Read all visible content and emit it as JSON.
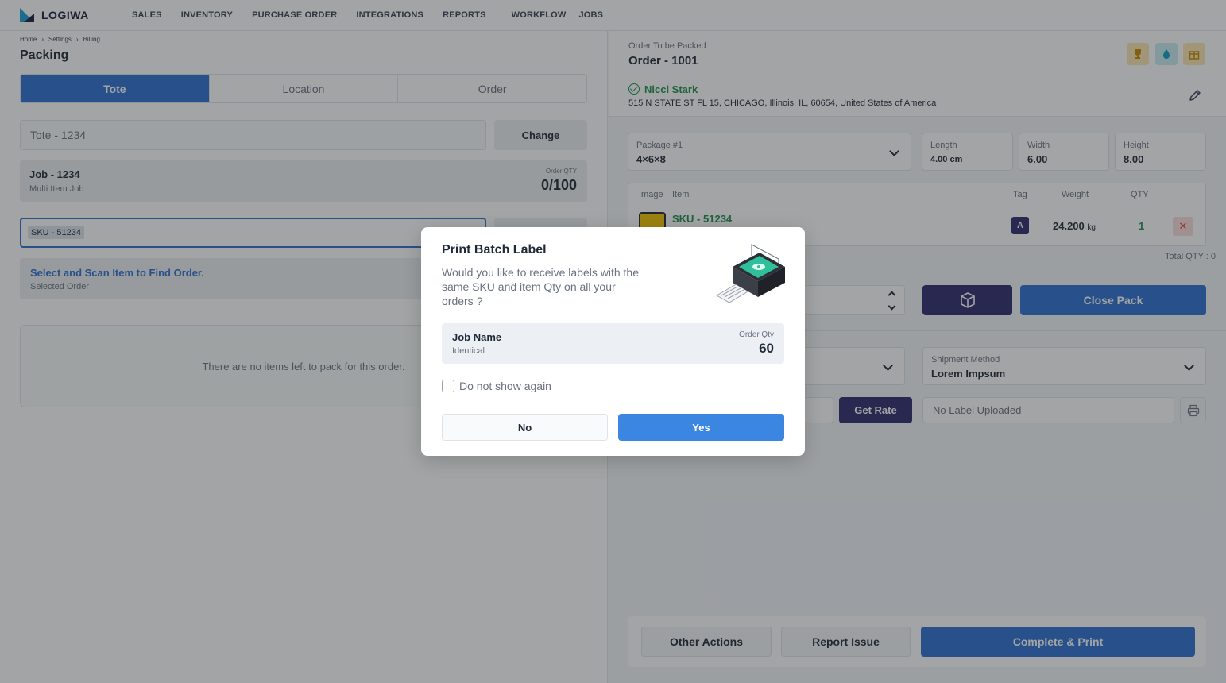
{
  "brand": {
    "name": "LOGIWA"
  },
  "nav": {
    "items": [
      "SALES",
      "INVENTORY",
      "PURCHASE ORDER",
      "INTEGRATIONS",
      "REPORTS",
      "WORKFLOW",
      "JOBS"
    ]
  },
  "left": {
    "breadcrumb": [
      "Home",
      "Settings",
      "Billing"
    ],
    "title": "Packing",
    "tabs": [
      "Tote",
      "Location",
      "Order"
    ],
    "tote_value": "Tote - 1234",
    "change_label": "Change",
    "job": {
      "title": "Job - 1234",
      "subtitle": "Multi Item Job",
      "qty_label": "Order QTY",
      "qty_value": "0/100"
    },
    "sku_value": "SKU - 51234",
    "scan": {
      "title": "Select and Scan Item to Find Order.",
      "subtitle": "Selected Order"
    },
    "empty_text": "There are no items left to pack for this order."
  },
  "right": {
    "order_label": "Order To be Packed",
    "order_title": "Order - 1001",
    "customer": {
      "name": "Nicci Stark",
      "address": "515 N STATE ST FL 15, CHICAGO, Illinois, IL, 60654, United States of America"
    },
    "package": {
      "label": "Package #1",
      "value": "4×6×8"
    },
    "length": {
      "label": "Length",
      "value": "4.00 cm"
    },
    "width": {
      "label": "Width",
      "value": "6.00"
    },
    "height": {
      "label": "Height",
      "value": "8.00"
    },
    "table": {
      "headers": {
        "image": "Image",
        "item": "Item",
        "tag": "Tag",
        "weight": "Weight",
        "qty": "QTY"
      },
      "rows": [
        {
          "sku": "SKU - 51234",
          "tag": "A",
          "weight": "24.200",
          "weight_unit": "kg",
          "qty": "1"
        }
      ],
      "total": "Total QTY : 0"
    },
    "close_pack_label": "Close Pack",
    "shipment": {
      "label": "Shipment Method",
      "value": "Lorem Impsum"
    },
    "get_rate_label": "Get Rate",
    "label_status": "No Label Uploaded",
    "actions": {
      "other": "Other Actions",
      "report": "Report Issue",
      "complete": "Complete & Print"
    }
  },
  "modal": {
    "title": "Print Batch Label",
    "description": "Would you like to receive labels with the same SKU and item Qty on all your orders ?",
    "card": {
      "title": "Job Name",
      "subtitle": "Identical",
      "qty_label": "Order Qty",
      "qty_value": "60"
    },
    "checkbox_label": "Do not show again",
    "no_label": "No",
    "yes_label": "Yes"
  },
  "colors": {
    "primary": "#2d6fd1",
    "dark_accent": "#2d2a6e",
    "success": "#1f8f4e",
    "danger": "#e23c3c"
  }
}
